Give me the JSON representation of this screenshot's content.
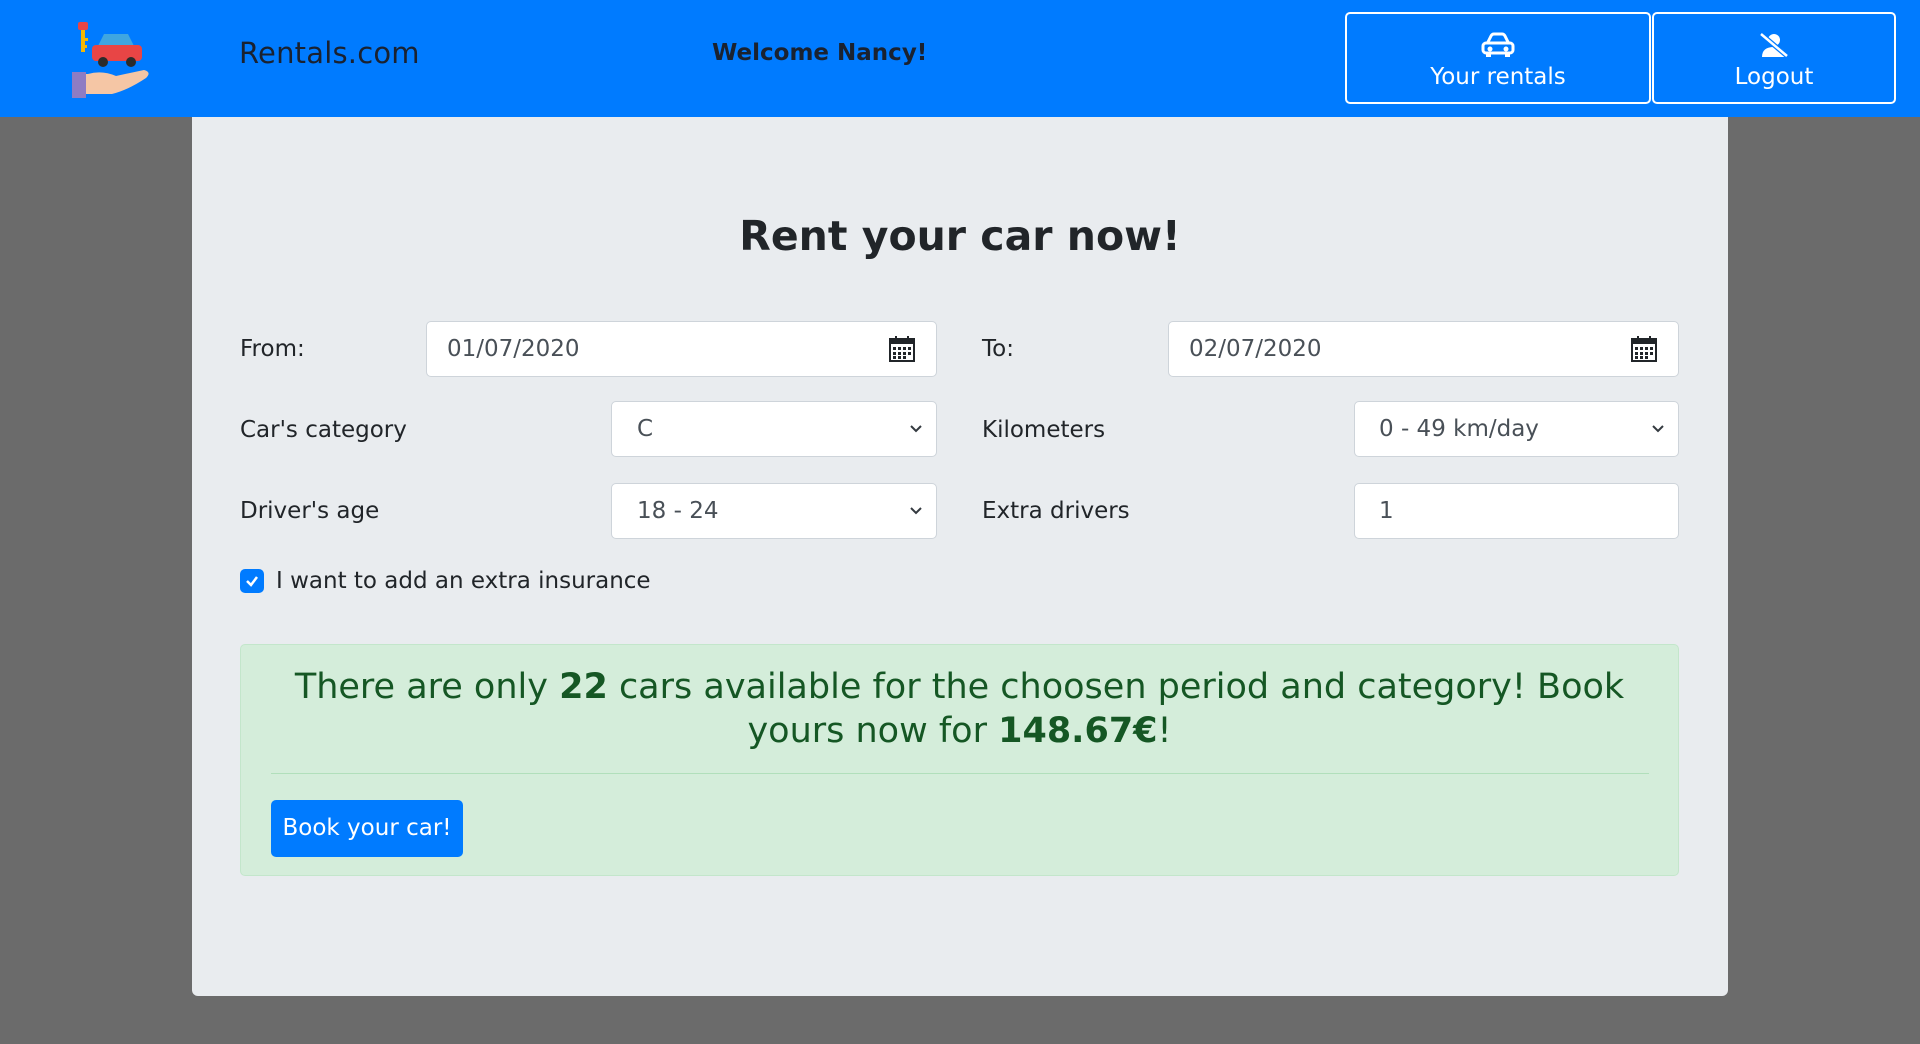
{
  "header": {
    "brand": "Rentals.com",
    "welcome": "Welcome Nancy!",
    "rentals_button": "Your rentals",
    "logout_button": "Logout"
  },
  "form": {
    "title": "Rent your car now!",
    "from_label": "From:",
    "from_value": "01/07/2020",
    "to_label": "To:",
    "to_value": "02/07/2020",
    "category_label": "Car's category",
    "category_value": "C",
    "kilometers_label": "Kilometers",
    "kilometers_value": "0 - 49 km/day",
    "age_label": "Driver's age",
    "age_value": "18 - 24",
    "extra_drivers_label": "Extra drivers",
    "extra_drivers_value": "1",
    "insurance_label": "I want to add an extra insurance",
    "insurance_checked": true
  },
  "availability": {
    "text_before": "There are only ",
    "count": "22",
    "text_middle": " cars available for the choosen period and category! Book yours now for ",
    "price": "148.67€",
    "text_after": "!",
    "book_button": "Book your car!"
  },
  "colors": {
    "navbar": "#007bff",
    "background": "#6b6b6b",
    "card": "#e9ecef",
    "alert_bg": "#d4edda",
    "alert_text": "#155724"
  }
}
